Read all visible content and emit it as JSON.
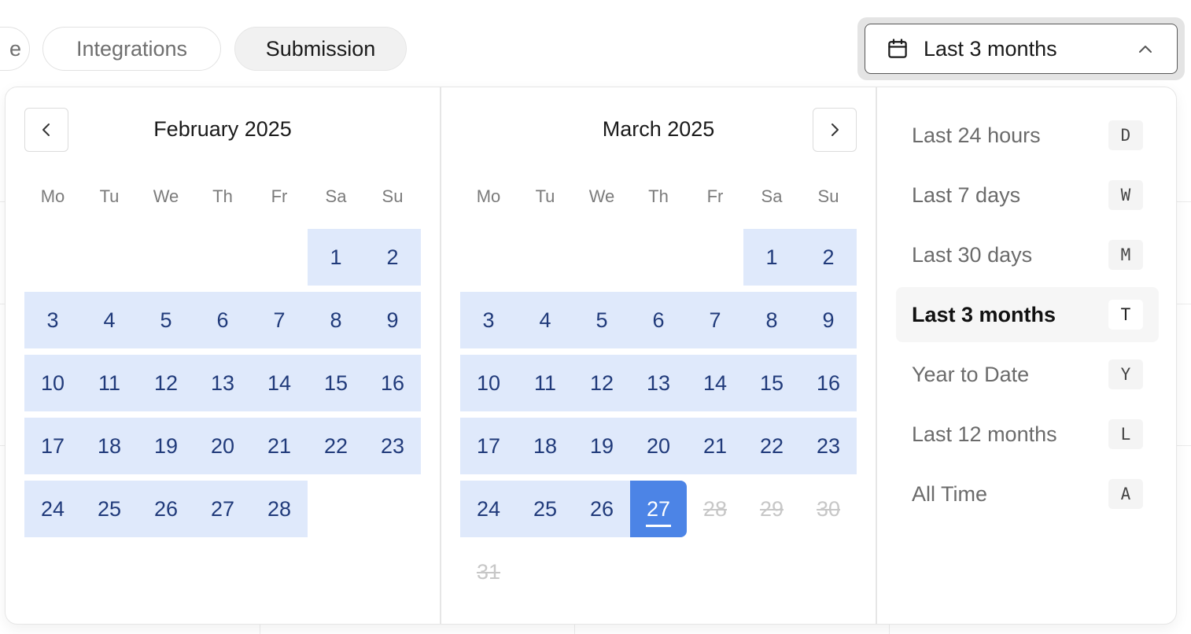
{
  "tabs": [
    {
      "label": "e",
      "active": false
    },
    {
      "label": "Integrations",
      "active": false
    },
    {
      "label": "Submission",
      "active": true
    }
  ],
  "date_range": {
    "label": "Last 3 months",
    "icon": "calendar-icon",
    "chevron": "chevron-up-icon"
  },
  "calendar": {
    "weekdays": [
      "Mo",
      "Tu",
      "We",
      "Th",
      "Fr",
      "Sa",
      "Su"
    ],
    "left_month": {
      "title": "February 2025",
      "weeks": [
        [
          "",
          "",
          "",
          "",
          "",
          "1",
          "2"
        ],
        [
          "3",
          "4",
          "5",
          "6",
          "7",
          "8",
          "9"
        ],
        [
          "10",
          "11",
          "12",
          "13",
          "14",
          "15",
          "16"
        ],
        [
          "17",
          "18",
          "19",
          "20",
          "21",
          "22",
          "23"
        ],
        [
          "24",
          "25",
          "26",
          "27",
          "28",
          "",
          ""
        ]
      ]
    },
    "right_month": {
      "title": "March 2025",
      "weeks": [
        [
          "",
          "",
          "",
          "",
          "",
          "1",
          "2"
        ],
        [
          "3",
          "4",
          "5",
          "6",
          "7",
          "8",
          "9"
        ],
        [
          "10",
          "11",
          "12",
          "13",
          "14",
          "15",
          "16"
        ],
        [
          "17",
          "18",
          "19",
          "20",
          "21",
          "22",
          "23"
        ],
        [
          "24",
          "25",
          "26",
          "27",
          "28",
          "29",
          "30"
        ],
        [
          "31",
          "",
          "",
          "",
          "",
          "",
          ""
        ]
      ],
      "selected_day": "27",
      "disabled_days": [
        "28",
        "29",
        "30",
        "31"
      ]
    },
    "prev_icon": "chevron-left-icon",
    "next_icon": "chevron-right-icon"
  },
  "presets": [
    {
      "label": "Last 24 hours",
      "key": "D",
      "active": false
    },
    {
      "label": "Last 7 days",
      "key": "W",
      "active": false
    },
    {
      "label": "Last 30 days",
      "key": "M",
      "active": false
    },
    {
      "label": "Last 3 months",
      "key": "T",
      "active": true
    },
    {
      "label": "Year to Date",
      "key": "Y",
      "active": false
    },
    {
      "label": "Last 12 months",
      "key": "L",
      "active": false
    },
    {
      "label": "All Time",
      "key": "A",
      "active": false
    }
  ],
  "colors": {
    "range_bg": "#dfe9fb",
    "range_text": "#203a7a",
    "selected_bg": "#4c84e6",
    "disabled_text": "#c7c7c7"
  }
}
